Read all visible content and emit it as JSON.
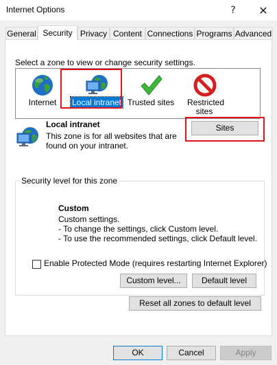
{
  "window": {
    "title": "Internet Options",
    "help_glyph": "?",
    "close_glyph": "✕"
  },
  "tabs": [
    {
      "label": "General",
      "active": false
    },
    {
      "label": "Security",
      "active": true
    },
    {
      "label": "Privacy",
      "active": false
    },
    {
      "label": "Content",
      "active": false
    },
    {
      "label": "Connections",
      "active": false
    },
    {
      "label": "Programs",
      "active": false
    },
    {
      "label": "Advanced",
      "active": false
    }
  ],
  "security": {
    "zone_prompt": "Select a zone to view or change security settings.",
    "zones": [
      {
        "label": "Internet",
        "icon": "globe-icon",
        "selected": false
      },
      {
        "label": "Local intranet",
        "icon": "intranet-icon",
        "selected": true
      },
      {
        "label": "Trusted sites",
        "icon": "checkmark-icon",
        "selected": false
      },
      {
        "label": "Restricted sites",
        "icon": "restricted-icon",
        "selected": false
      }
    ],
    "zone_info": {
      "title": "Local intranet",
      "description": "This zone is for all websites that are found on your intranet.",
      "sites_button": "Sites"
    },
    "level_group": {
      "legend": "Security level for this zone",
      "level_title": "Custom",
      "level_lines": [
        "Custom settings.",
        "- To change the settings, click Custom level.",
        "- To use the recommended settings, click Default level."
      ]
    },
    "protected_mode": {
      "label": "Enable Protected Mode (requires restarting Internet Explorer)",
      "checked": false
    },
    "custom_level_button": "Custom level...",
    "default_level_button": "Default level",
    "reset_all_button": "Reset all zones to default level"
  },
  "footer": {
    "ok": "OK",
    "cancel": "Cancel",
    "apply": "Apply"
  },
  "colors": {
    "selection": "#0078d7",
    "highlight_box": "#e3121c"
  }
}
